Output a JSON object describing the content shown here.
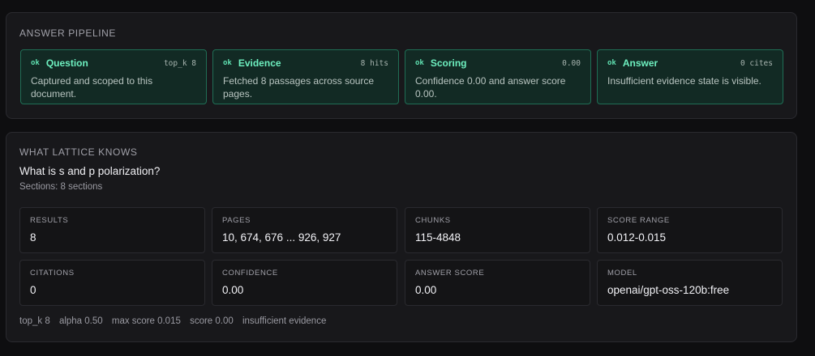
{
  "pipeline": {
    "title": "ANSWER PIPELINE",
    "stages": [
      {
        "status": "ok",
        "name": "Question",
        "meta": "top_k 8",
        "desc": "Captured and scoped to this document."
      },
      {
        "status": "ok",
        "name": "Evidence",
        "meta": "8 hits",
        "desc": "Fetched 8 passages across source pages."
      },
      {
        "status": "ok",
        "name": "Scoring",
        "meta": "0.00",
        "desc": "Confidence 0.00 and answer score 0.00."
      },
      {
        "status": "ok",
        "name": "Answer",
        "meta": "0 cites",
        "desc": "Insufficient evidence state is visible."
      }
    ]
  },
  "knows": {
    "title": "WHAT LATTICE KNOWS",
    "question": "What is s and p polarization?",
    "sections": "Sections: 8 sections",
    "stats": [
      {
        "label": "RESULTS",
        "value": "8"
      },
      {
        "label": "PAGES",
        "value": "10, 674, 676 ... 926, 927"
      },
      {
        "label": "CHUNKS",
        "value": "115-4848"
      },
      {
        "label": "SCORE RANGE",
        "value": "0.012-0.015"
      },
      {
        "label": "CITATIONS",
        "value": "0"
      },
      {
        "label": "CONFIDENCE",
        "value": "0.00"
      },
      {
        "label": "ANSWER SCORE",
        "value": "0.00"
      },
      {
        "label": "MODEL",
        "value": "openai/gpt-oss-120b:free"
      }
    ],
    "footer": [
      "top_k 8",
      "alpha 0.50",
      "max score 0.015",
      "score 0.00",
      "insufficient evidence"
    ]
  }
}
